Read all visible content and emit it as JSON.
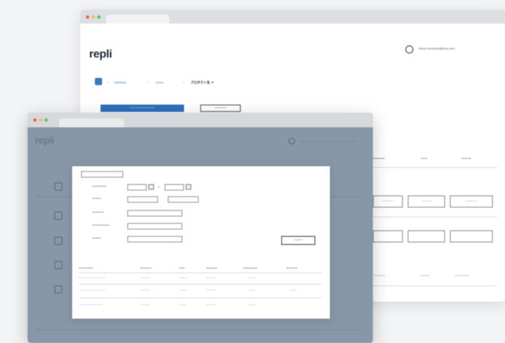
{
  "colors": {
    "accent": "#2f6fbd",
    "link": "#3b78c2",
    "overlay": "#8897a8",
    "dot_red": "#ee5f57",
    "dot_yellow": "#f5be4f",
    "dot_green": "#5fc453"
  },
  "back_window": {
    "logo": "repli",
    "user_email": "itooo.ooooooo@ooo.ooo",
    "breadcrumb": {
      "items": [
        "Webtour",
        "Oooo"
      ],
      "current": "プロダクト名 ▼"
    },
    "primary_button": "ーーーーーーーーー",
    "secondary_button": "ーーーー",
    "note": "ーーーーーーーーーーーーーーーーーーーーーーーーーーーーーーーーーーーー",
    "table_headers": [
      "ーーーー",
      "ーー",
      "ーーー"
    ],
    "row_buttons": [
      "ーーーーー",
      "ーーーー",
      "ーーーーー"
    ],
    "row_texts": [
      "ーーーー",
      "ーーー",
      "ーーーーー"
    ]
  },
  "front_window": {
    "logo": "repli",
    "modal": {
      "labels": [
        "ーーーーー",
        "ーーー",
        "ーーーー",
        "ーーーーーー",
        "ーーー"
      ],
      "search_button": "ーーー",
      "table_headers": [
        "ーーーーー",
        "ーーーー",
        "ーー",
        "ーーーー",
        "ーーーーー",
        "ーーーー"
      ],
      "rows": [
        {
          "name": "ーーーーーーーーーーー",
          "c1": "ーーーー",
          "c2": "ーーー",
          "c3": "ーーーー",
          "c4": "ーーー",
          "c5": ""
        },
        {
          "name": "ーーーーーーーーーーー",
          "c1": "ーーーー",
          "c2": "ーーー",
          "c3": "ーーーー",
          "c4": "ーーー",
          "c5": "ーーー"
        },
        {
          "name": "ーーーーーーーーーー",
          "c1": "ーーーー",
          "c2": "ーーー",
          "c3": "ーーーー",
          "c4": "ーーー",
          "c5": ""
        }
      ]
    }
  }
}
